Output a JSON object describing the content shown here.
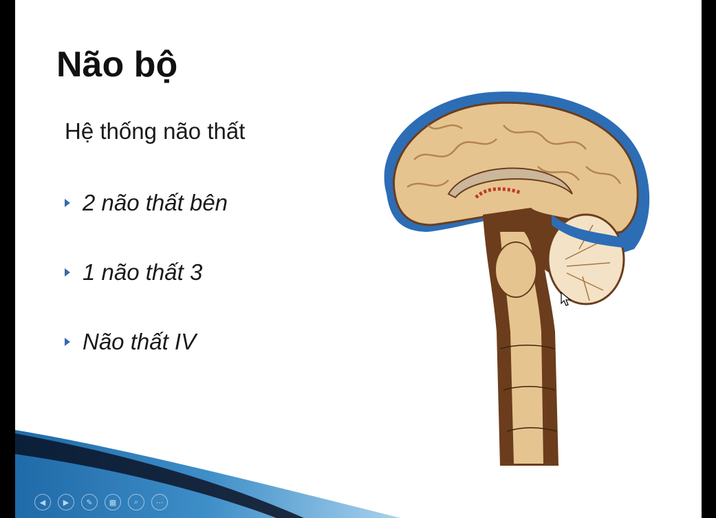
{
  "slide": {
    "title": "Não bộ",
    "subtitle": "Hệ thống não thất",
    "bullets": [
      {
        "text": "2 não thất bên"
      },
      {
        "text": "1 não thất 3"
      },
      {
        "text": "Não thất IV"
      }
    ]
  },
  "diagram": {
    "icon": "brain-sagittal-section-illustration"
  },
  "controls": [
    {
      "icon": "previous-icon",
      "glyph": "◀"
    },
    {
      "icon": "next-icon",
      "glyph": "▶"
    },
    {
      "icon": "pen-icon",
      "glyph": "✎"
    },
    {
      "icon": "slides-icon",
      "glyph": "▦"
    },
    {
      "icon": "zoom-icon",
      "glyph": "⌕"
    },
    {
      "icon": "more-icon",
      "glyph": "⋯"
    }
  ],
  "colors": {
    "background": "#000000",
    "slide": "#ffffff",
    "accent_blue": "#2d6db5",
    "bullet_arrow": "#3a6aa8",
    "brain_tan": "#e6c490",
    "brain_brown": "#6b3d1c"
  }
}
